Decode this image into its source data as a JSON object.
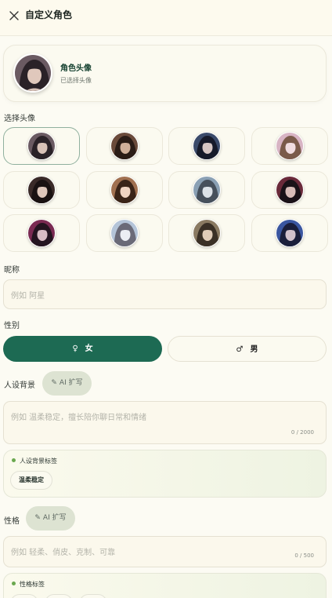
{
  "header": {
    "title": "自定义角色",
    "close_icon": "close-icon"
  },
  "profile": {
    "title": "角色头像",
    "subtitle": "已选择头像"
  },
  "avatars": {
    "label": "选择头像",
    "selected_index": 0,
    "items": [
      {
        "name": "avatar-1",
        "colors": [
          "#6a5a62",
          "#2a2228",
          "#d8c2b8"
        ]
      },
      {
        "name": "avatar-2",
        "colors": [
          "#6a4a3a",
          "#2a1c16",
          "#d0b09a"
        ]
      },
      {
        "name": "avatar-3",
        "colors": [
          "#3a4a6a",
          "#161a2a",
          "#d6c6c4"
        ]
      },
      {
        "name": "avatar-4",
        "colors": [
          "#d8b4c4",
          "#7a5a4a",
          "#f0dce0"
        ]
      },
      {
        "name": "avatar-5",
        "colors": [
          "#3a2a28",
          "#1a1212",
          "#e0c8bc"
        ]
      },
      {
        "name": "avatar-6",
        "colors": [
          "#a07050",
          "#3a2418",
          "#f0d4c2"
        ]
      },
      {
        "name": "avatar-7",
        "colors": [
          "#8aa0b4",
          "#46505c",
          "#dce2e8"
        ]
      },
      {
        "name": "avatar-8",
        "colors": [
          "#6a2a3a",
          "#1a1218",
          "#d8bcb8"
        ]
      },
      {
        "name": "avatar-9",
        "colors": [
          "#7a2a52",
          "#241420",
          "#d8bcc4"
        ]
      },
      {
        "name": "avatar-10",
        "colors": [
          "#b4c4d8",
          "#6a6a78",
          "#eceef4"
        ]
      },
      {
        "name": "avatar-11",
        "colors": [
          "#8a7a62",
          "#3a3026",
          "#e0ccb8"
        ]
      },
      {
        "name": "avatar-12",
        "colors": [
          "#3a56a0",
          "#1a1e3a",
          "#d2c2cc"
        ]
      }
    ]
  },
  "nickname": {
    "label": "昵称",
    "placeholder": "例如 阿星"
  },
  "gender": {
    "label": "性别",
    "female_symbol": "♀",
    "female": "女",
    "male_symbol": "♂",
    "male": "男",
    "selected": "female"
  },
  "background": {
    "label": "人设背景",
    "ai_button": "AI 扩写",
    "placeholder": "例如 温柔稳定，擅长陪你聊日常和情绪",
    "counter": "0 / 2000",
    "tags_title": "人设背景标签",
    "tags": [
      "温柔稳定"
    ]
  },
  "personality": {
    "label": "性格",
    "ai_button": "AI 扩写",
    "placeholder": "例如 轻柔、俏皮、克制、可靠",
    "counter": "0 / 500",
    "tags_title": "性格标签"
  },
  "colors": {
    "accent": "#1d6a53",
    "background": "#fcfbf3"
  }
}
